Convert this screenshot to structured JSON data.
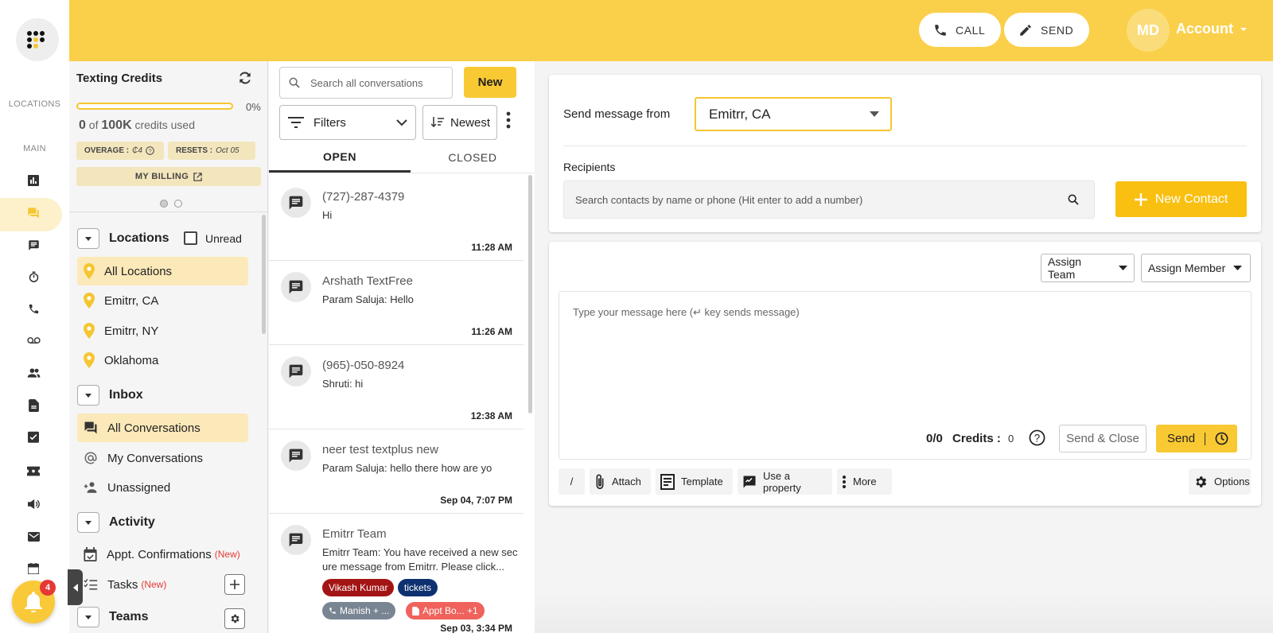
{
  "topbar": {
    "call_label": "CALL",
    "send_label": "SEND",
    "avatar_initials": "MD",
    "account_label": "Account"
  },
  "rail": {
    "locations_label": "LOCATIONS",
    "main_label": "MAIN",
    "icons": [
      "dashboard-icon",
      "conversations-icon",
      "chat-icon",
      "timer-icon",
      "phone-icon",
      "voicemail-icon",
      "contacts-icon",
      "document-icon",
      "tasks-icon",
      "ticket-icon",
      "campaign-icon",
      "email-icon",
      "calendar-icon"
    ],
    "notification_count": "4"
  },
  "credits": {
    "title": "Texting Credits",
    "percent_used": 0,
    "percent_label": "0%",
    "used": "0",
    "of_label": "of",
    "total": "100K",
    "suffix": "credits used",
    "overage_label": "OVERAGE :",
    "overage_value": "₵4",
    "resets_label": "RESETS :",
    "resets_value": "Oct 05",
    "billing_label": "MY BILLING"
  },
  "sidebar": {
    "locations_title": "Locations",
    "unread_label": "Unread",
    "locations": [
      "All Locations",
      "Emitrr, CA",
      "Emitrr, NY",
      "Oklahoma"
    ],
    "inbox_title": "Inbox",
    "inbox_items": [
      "All Conversations",
      "My Conversations",
      "Unassigned"
    ],
    "activity_title": "Activity",
    "activity_items": [
      {
        "label": "Appt. Confirmations",
        "tag": "(New)"
      },
      {
        "label": "Tasks",
        "tag": "(New)"
      }
    ],
    "teams_title": "Teams"
  },
  "conversations": {
    "search_placeholder": "Search all conversations",
    "new_label": "New",
    "filters_label": "Filters",
    "sort_label": "Newest",
    "tabs": [
      "OPEN",
      "CLOSED"
    ],
    "items": [
      {
        "name": "(727)-287-4379",
        "message": "Hi",
        "time": "11:28 AM"
      },
      {
        "name": "Arshath TextFree",
        "message": "Param Saluja:  Hello",
        "time": "11:26 AM"
      },
      {
        "name": "(965)-050-8924",
        "message": "Shruti:  hi",
        "time": "12:38 AM"
      },
      {
        "name": "neer test textplus new",
        "message": "Param Saluja:  hello there how are yo",
        "time": "Sep 04, 7:07 PM"
      },
      {
        "name": "Emitrr Team",
        "message": "Emitrr Team:  You have received a new secure message from Emitrr. Please click...",
        "time": "Sep 03, 3:34 PM",
        "tags": [
          "Vikash Kumar",
          "tickets",
          "Manish + ...",
          "Appt Bo... +1"
        ]
      }
    ]
  },
  "compose": {
    "send_from_label": "Send message from",
    "send_from_value": "Emitrr, CA",
    "recipients_label": "Recipients",
    "recipients_placeholder": "Search contacts by name or phone (Hit enter to add a number)",
    "new_contact_label": "New Contact",
    "assign_team_label": "Assign Team",
    "assign_member_label": "Assign Member",
    "message_placeholder": "Type your message here (↵ key sends message)",
    "char_count": "0/0",
    "credits_label": "Credits :",
    "credits_value": "0",
    "send_close_label": "Send & Close",
    "send_label": "Send",
    "tools": {
      "slash": "/",
      "attach": "Attach",
      "template": "Template",
      "property": "Use a property",
      "more": "More",
      "options": "Options"
    }
  },
  "colors": {
    "brand_yellow": "#fad04a",
    "accent": "#f9c933",
    "tag_red": "#a31515",
    "tag_navy": "#0d3170",
    "tag_grey": "#7a8594",
    "tag_pink": "#f0625c"
  }
}
